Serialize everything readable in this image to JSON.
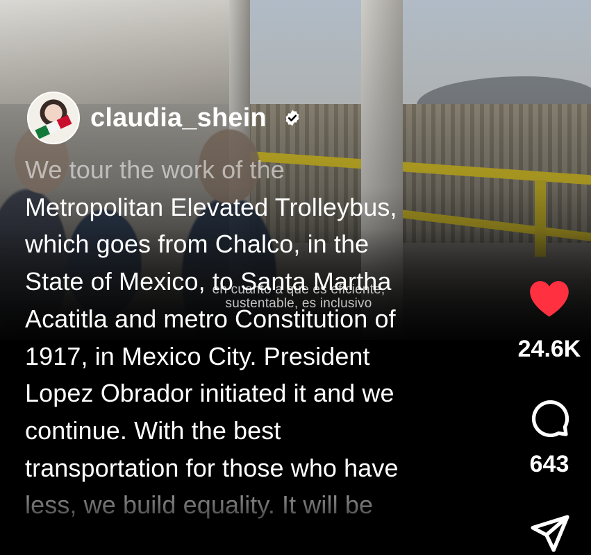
{
  "post": {
    "username": "claudia_shein",
    "verified": true,
    "caption_lines": [
      "We tour the work of the",
      "Metropolitan Elevated Trolleybus,",
      "which goes from Chalco, in the",
      "State of Mexico, to Santa Martha",
      "Acatitla and metro Constitution of",
      "1917, in Mexico City. President",
      "Lopez Obrador initiated it and we",
      "continue. With the best",
      "transportation for those who have",
      "less, we build equality. It will be"
    ]
  },
  "video": {
    "subtitle_lines": [
      "en cuanto a que es eficiente,",
      "sustentable, es inclusivo"
    ]
  },
  "actions": {
    "like": {
      "icon": "heart-icon",
      "count": "24.6K",
      "liked": true,
      "color": "#ff3040"
    },
    "comment": {
      "icon": "comment-bubble-icon",
      "count": "643"
    },
    "share": {
      "icon": "send-paper-plane-icon"
    }
  }
}
